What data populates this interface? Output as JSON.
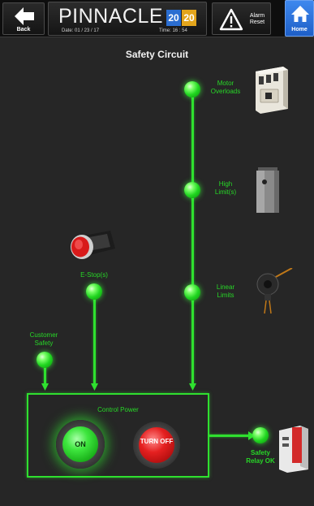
{
  "header": {
    "back_label": "Back",
    "brand_name": "PINNACLE",
    "brand_year_part1": "20",
    "brand_year_part2": "20",
    "date": "Date: 01 / 23 / 17",
    "time": "Time: 16 : 54",
    "alarm_label": "Alarm Reset",
    "home_label": "Home"
  },
  "title": "Safety Circuit",
  "inputs": {
    "motor_overloads": "Motor Overloads",
    "high_limits": "High Limit(s)",
    "linear_limits": "Linear Limits",
    "estops": "E-Stop(s)",
    "customer_safety": "Customer Safety"
  },
  "control_power": {
    "title": "Control Power",
    "on_label": "ON",
    "off_label": "TURN OFF"
  },
  "safety_relay": {
    "label": "Safety Relay OK"
  },
  "colors": {
    "wire_green": "#2fe02f",
    "label_green": "#27d827",
    "home_blue": "#2f74e0",
    "year_blue": "#2b6ed1",
    "year_orange": "#e3a51c",
    "off_red": "#e52020"
  },
  "icons": {
    "back": "arrow-left-icon",
    "alarm": "warning-triangle-icon",
    "home": "home-icon"
  }
}
